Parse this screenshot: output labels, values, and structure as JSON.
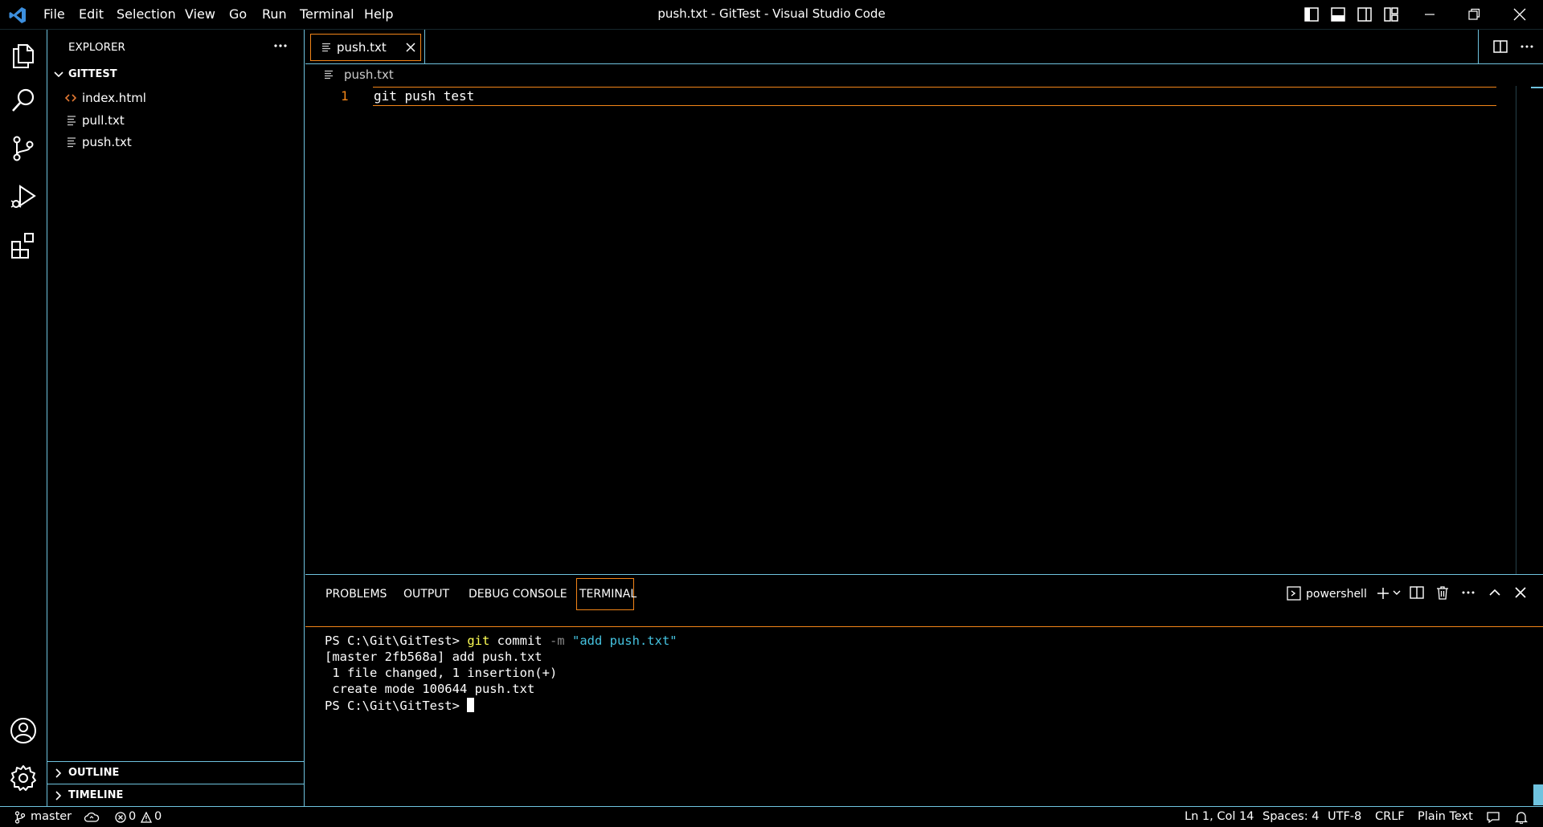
{
  "titlebar": {
    "title": "push.txt - GitTest - Visual Studio Code",
    "menu": [
      "File",
      "Edit",
      "Selection",
      "View",
      "Go",
      "Run",
      "Terminal",
      "Help"
    ]
  },
  "sidebar": {
    "header": "EXPLORER",
    "folder": "GITTEST",
    "files": [
      {
        "name": "index.html",
        "icon": "html-file-icon"
      },
      {
        "name": "pull.txt",
        "icon": "text-file-icon"
      },
      {
        "name": "push.txt",
        "icon": "text-file-icon"
      }
    ],
    "outline": "OUTLINE",
    "timeline": "TIMELINE"
  },
  "editor": {
    "tab_label": "push.txt",
    "breadcrumb": "push.txt",
    "line_number": "1",
    "line_text": "git push test"
  },
  "panel": {
    "tabs": [
      "PROBLEMS",
      "OUTPUT",
      "DEBUG CONSOLE",
      "TERMINAL"
    ],
    "active_tab": "TERMINAL",
    "shell": "powershell",
    "terminal": {
      "prompt": "PS C:\\Git\\GitTest> ",
      "cmd_git": "git",
      "cmd_rest": " commit ",
      "cmd_flag": "-m",
      "cmd_str": "\"add push.txt\"",
      "out1": "[master 2fb568a] add push.txt",
      "out2": " 1 file changed, 1 insertion(+)",
      "out3": " create mode 100644 push.txt",
      "prompt2": "PS C:\\Git\\GitTest> "
    }
  },
  "statusbar": {
    "branch": "master",
    "errors": "0",
    "warnings": "0",
    "position": "Ln 1, Col 14",
    "spaces": "Spaces: 4",
    "encoding": "UTF-8",
    "eol": "CRLF",
    "language": "Plain Text"
  },
  "colors": {
    "accent_border": "#6fc3df",
    "active_border": "#f38518",
    "vscode_blue": "#3c8fde",
    "html_icon": "#e37933"
  }
}
